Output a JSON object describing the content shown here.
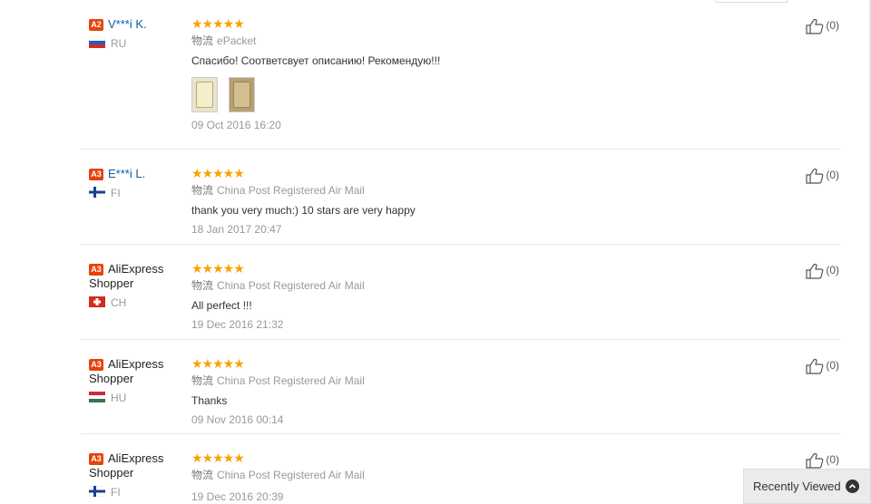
{
  "reviews": [
    {
      "level": "A2",
      "name": "V***i K.",
      "country": "RU",
      "stars": "★★★★★",
      "logistics_label": "物流",
      "logistics": "ePacket",
      "text": "Спасибо! Соответсвует описанию! Рекомендую!!!",
      "date": "09 Oct 2016 16:20",
      "likes": "(0)"
    },
    {
      "level": "A3",
      "name": "E***i L.",
      "country": "FI",
      "stars": "★★★★★",
      "logistics_label": "物流",
      "logistics": "China Post Registered Air Mail",
      "text": "thank you very much:) 10 stars are very happy",
      "date": "18 Jan 2017 20:47",
      "likes": "(0)"
    },
    {
      "level": "A3",
      "name": "AliExpress Shopper",
      "country": "CH",
      "stars": "★★★★★",
      "logistics_label": "物流",
      "logistics": "China Post Registered Air Mail",
      "text": "All perfect !!!",
      "date": "19 Dec 2016 21:32",
      "likes": "(0)"
    },
    {
      "level": "A3",
      "name": "AliExpress Shopper",
      "country": "HU",
      "stars": "★★★★★",
      "logistics_label": "物流",
      "logistics": "China Post Registered Air Mail",
      "text": "Thanks",
      "date": "09 Nov 2016 00:14",
      "likes": "(0)"
    },
    {
      "level": "A3",
      "name": "AliExpress Shopper",
      "country": "FI",
      "stars": "★★★★★",
      "logistics_label": "物流",
      "logistics": "China Post Registered Air Mail",
      "text": "",
      "date": "19 Dec 2016 20:39",
      "likes": "(0)"
    }
  ],
  "recently_viewed": {
    "label": "Recently Viewed",
    "icon": "chevron-up-icon"
  },
  "colors": {
    "star": "#f5a400",
    "level_badge": "#e8420b",
    "username": "#0b5ea8"
  }
}
